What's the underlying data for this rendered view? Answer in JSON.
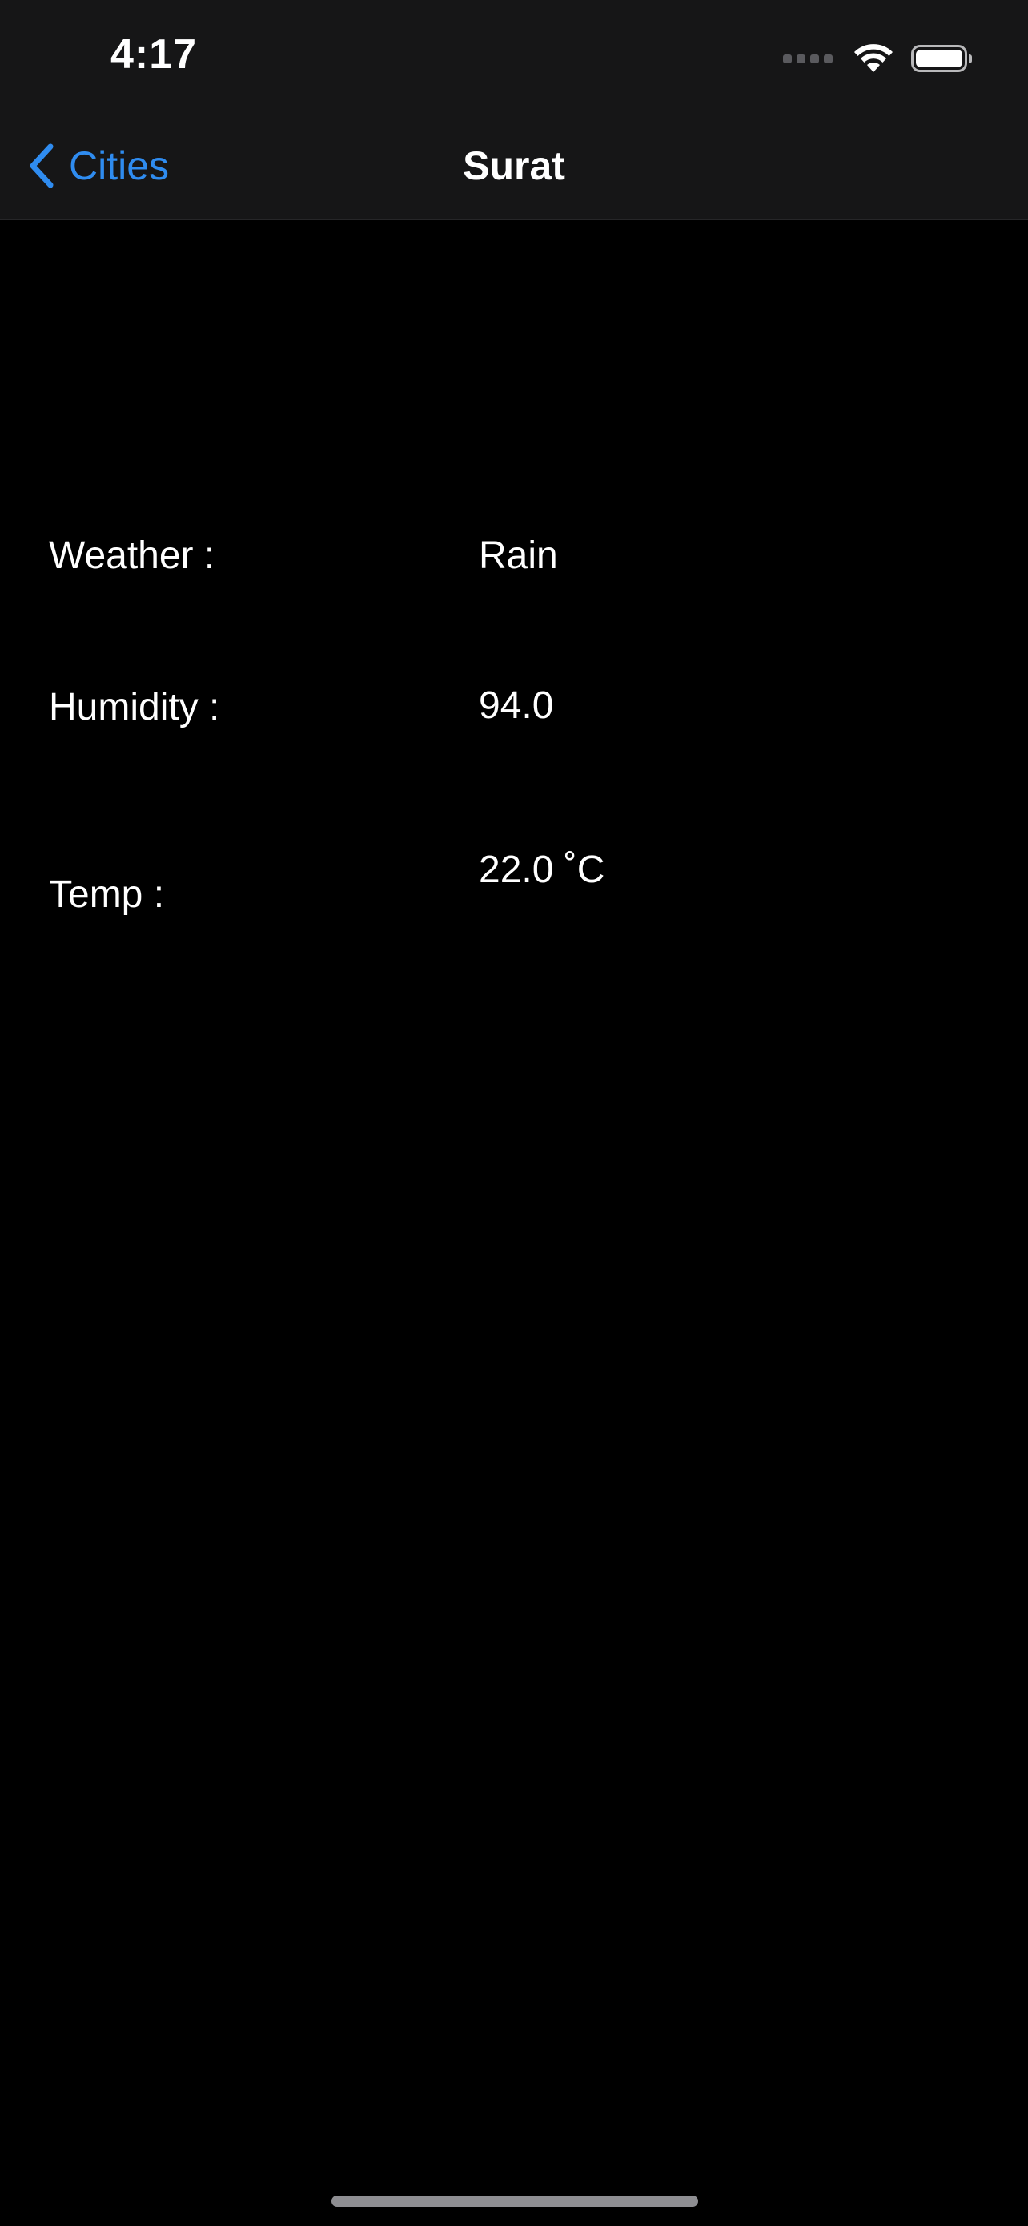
{
  "status_bar": {
    "time": "4:17",
    "icons": [
      "signal-icon",
      "wifi-icon",
      "battery-icon"
    ]
  },
  "nav": {
    "back_label": "Cities",
    "title": "Surat",
    "accent_color": "#2f8cf0"
  },
  "details": {
    "weather_label": "Weather :",
    "weather_value": "Rain",
    "humidity_label": "Humidity :",
    "humidity_value": "94.0",
    "temp_label": "Temp :",
    "temp_value": "22.0 ˚C"
  }
}
